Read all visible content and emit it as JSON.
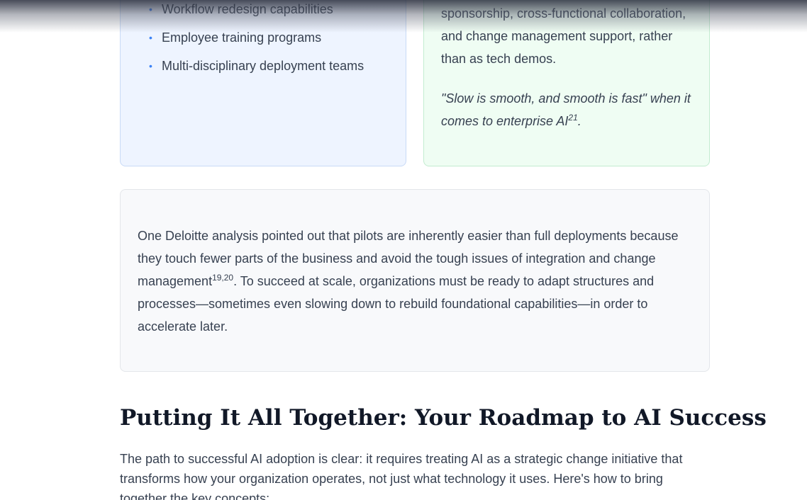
{
  "capabilities_card": {
    "items": [
      "Workflow redesign capabilities",
      "Employee training programs",
      "Multi-disciplinary deployment teams"
    ]
  },
  "approach_card": {
    "text": "sponsorship, cross-functional collaboration, and change management support, rather than as tech demos.",
    "quote": "\"Slow is smooth, and smooth is fast\" when it comes to enterprise AI",
    "quote_ref": "21",
    "quote_end": "."
  },
  "deloitte_note": {
    "part1": "One Deloitte analysis pointed out that pilots are inherently easier than full deployments because they touch fewer parts of the business and avoid the tough issues of integration and change management",
    "ref": "19,20",
    "part2": ". To succeed at scale, organizations must be ready to adapt structures and processes—sometimes even slowing down to rebuild foundational capabilities—in order to accelerate later."
  },
  "section": {
    "heading": "Putting It All Together: Your Roadmap to AI Success",
    "intro": "The path to successful AI adoption is clear: it requires treating AI as a strategic change initiative that transforms how your organization operates, not just what technology it uses. Here's how to bring together the key concepts:"
  },
  "colors": {
    "bullet": "#3b82f6",
    "blue_card_bg": "#eef4ff",
    "green_card_bg": "#effdf3",
    "gray_card_bg": "#f8f9fb",
    "heading": "#111827",
    "body_text": "#374151"
  }
}
